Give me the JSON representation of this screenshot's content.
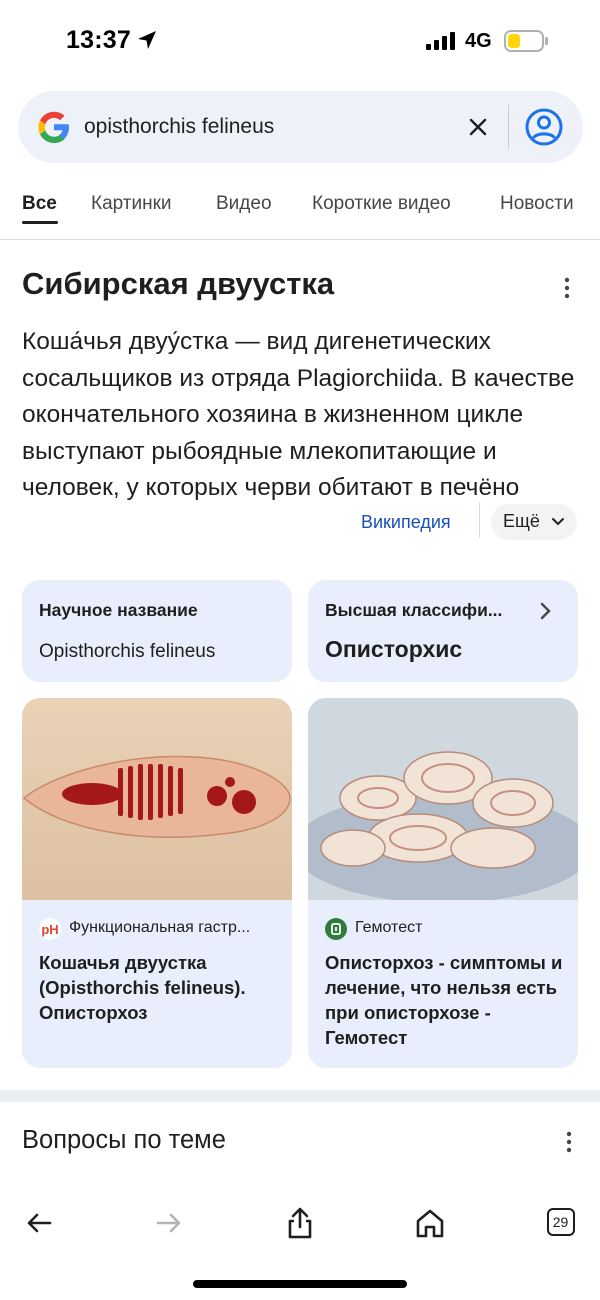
{
  "status_bar": {
    "time": "13:37",
    "network": "4G",
    "battery_color": "#ffd60a"
  },
  "search": {
    "query": "opisthorchis felineus"
  },
  "tabs": [
    {
      "label": "Все",
      "active": true
    },
    {
      "label": "Картинки"
    },
    {
      "label": "Видео"
    },
    {
      "label": "Короткие видео"
    },
    {
      "label": "Новости"
    }
  ],
  "knowledge": {
    "title": "Сибирская двуустка",
    "description": "Коша́чья двуу́стка — вид дигенетических сосальщиков из отряда Plagiorchiida. В качестве окончательного хозяина в жизненном цикле выступают рыбоядные млекопитающие и человек, у которых черви обитают в печёно",
    "source_link": "Википедия",
    "more_label": "Ещё"
  },
  "attributes": [
    {
      "label": "Научное название",
      "value": "Opisthorchis felineus"
    },
    {
      "label": "Высшая классифи...",
      "value": "Описторхис"
    }
  ],
  "results": [
    {
      "source": "Функциональная гастр...",
      "title": "Кошачья двуустка (Opisthorchis felineus). Описторхоз",
      "icon": "gastro-site-icon"
    },
    {
      "source": "Гемотест",
      "title": "Описторхоз - симптомы и лечение, что нельзя есть при описторхозе - Гемотест",
      "icon": "gemotest-icon"
    }
  ],
  "questions": {
    "title": "Вопросы по теме"
  },
  "toolbar": {
    "tab_count": "29"
  },
  "colors": {
    "accent": "#1a73e8",
    "card_bg": "#e8eefb",
    "link": "#1a4fb8"
  }
}
